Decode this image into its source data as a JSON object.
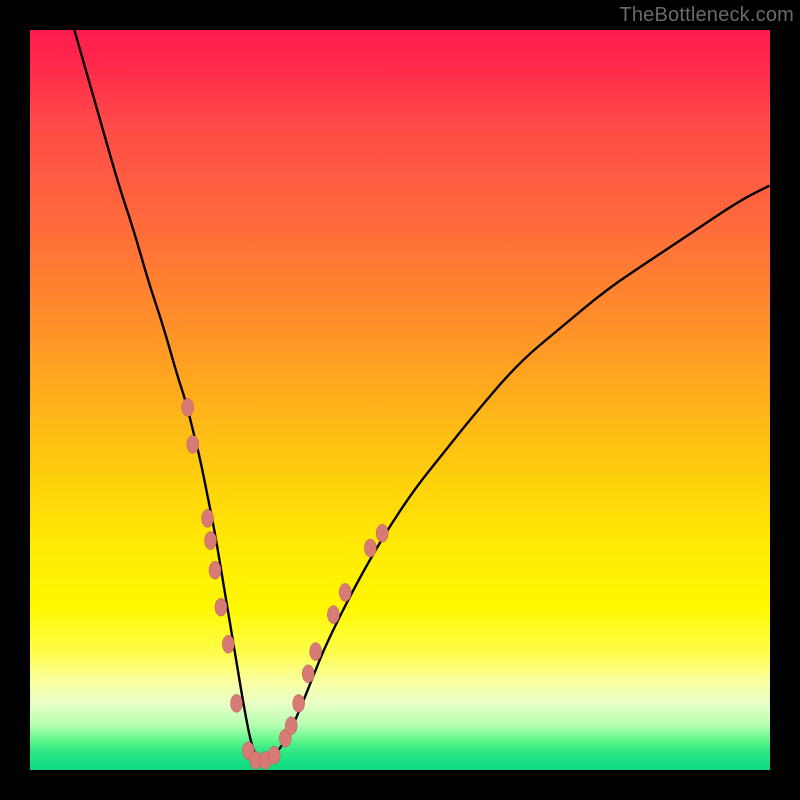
{
  "watermark": "TheBottleneck.com",
  "chart_data": {
    "type": "line",
    "title": "",
    "xlabel": "",
    "ylabel": "",
    "xlim": [
      0,
      100
    ],
    "ylim": [
      0,
      100
    ],
    "grid": false,
    "legend": false,
    "series": [
      {
        "name": "curve",
        "color": "#000000",
        "x": [
          6,
          8,
          10,
          12,
          14,
          16,
          18,
          20,
          21,
          22,
          23,
          24,
          25,
          26,
          27,
          28,
          29,
          30,
          31,
          32,
          34,
          36,
          38,
          40,
          44,
          48,
          52,
          56,
          60,
          66,
          72,
          78,
          84,
          90,
          96,
          100
        ],
        "y": [
          100,
          93,
          86,
          79,
          73,
          66,
          60,
          53,
          50,
          46,
          42,
          37,
          32,
          26,
          20,
          14,
          8,
          3,
          1.2,
          1.2,
          3,
          7,
          12,
          17,
          25,
          32,
          38,
          43,
          48,
          55,
          60,
          65,
          69,
          73,
          77,
          79
        ]
      }
    ],
    "markers": [
      {
        "x": 21.3,
        "y": 49
      },
      {
        "x": 22.0,
        "y": 44
      },
      {
        "x": 24.0,
        "y": 34
      },
      {
        "x": 24.4,
        "y": 31
      },
      {
        "x": 25.0,
        "y": 27
      },
      {
        "x": 25.8,
        "y": 22
      },
      {
        "x": 26.8,
        "y": 17
      },
      {
        "x": 27.9,
        "y": 9
      },
      {
        "x": 29.5,
        "y": 2.6
      },
      {
        "x": 30.5,
        "y": 1.3
      },
      {
        "x": 31.8,
        "y": 1.3
      },
      {
        "x": 33.0,
        "y": 2.0
      },
      {
        "x": 34.5,
        "y": 4.3
      },
      {
        "x": 35.3,
        "y": 6.0
      },
      {
        "x": 36.3,
        "y": 9.0
      },
      {
        "x": 37.6,
        "y": 13
      },
      {
        "x": 38.6,
        "y": 16
      },
      {
        "x": 41.0,
        "y": 21
      },
      {
        "x": 42.6,
        "y": 24
      },
      {
        "x": 46.0,
        "y": 30
      },
      {
        "x": 47.6,
        "y": 32
      }
    ],
    "marker_style": {
      "color": "#d87b76",
      "rx": 6,
      "ry": 9,
      "stroke": "#b85b55"
    }
  }
}
